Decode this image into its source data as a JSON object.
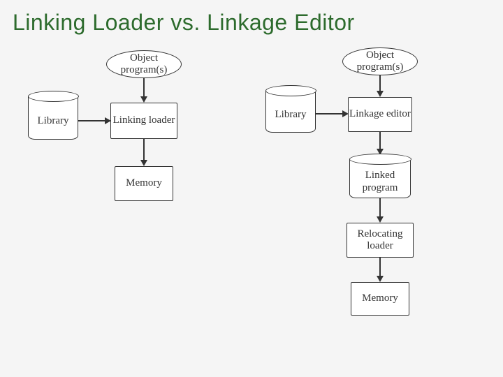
{
  "title": "Linking Loader   vs.   Linkage Editor",
  "left": {
    "object": "Object program(s)",
    "library": "Library",
    "loader": "Linking loader",
    "memory": "Memory"
  },
  "right": {
    "object": "Object program(s)",
    "library": "Library",
    "editor": "Linkage editor",
    "linked": "Linked program",
    "reloc": "Relocating loader",
    "memory": "Memory"
  }
}
